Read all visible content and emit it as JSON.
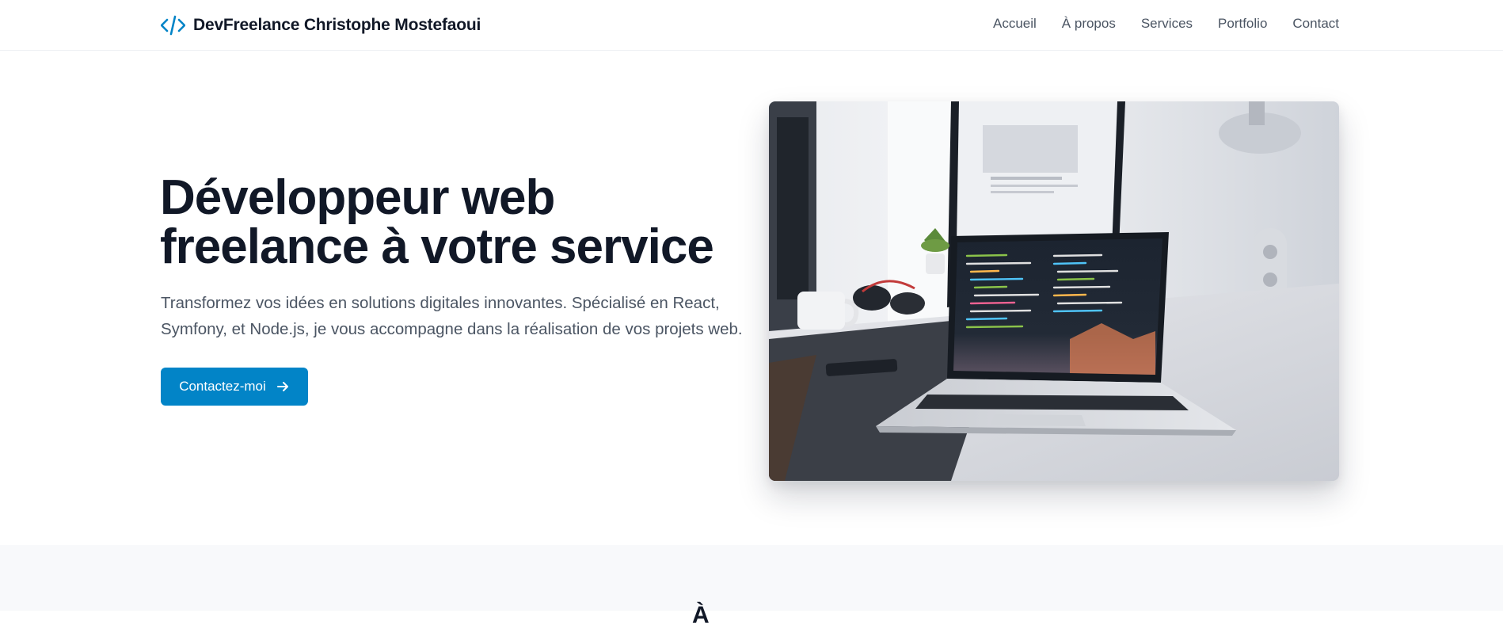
{
  "brand": {
    "icon": "code-icon",
    "name": "DevFreelance Christophe Mostefaoui",
    "accent_color": "#0284c7"
  },
  "nav": {
    "items": [
      {
        "label": "Accueil"
      },
      {
        "label": "À propos"
      },
      {
        "label": "Services"
      },
      {
        "label": "Portfolio"
      },
      {
        "label": "Contact"
      }
    ]
  },
  "hero": {
    "title_line1": "Développeur web",
    "title_line2": "freelance à votre service",
    "subtitle_line1": "Transformez vos idées en solutions digitales innovantes. Spécialisé en React,",
    "subtitle_line2": "Symfony, et Node.js, je vous accompagne dans la réalisation de vos projets web.",
    "cta_label": "Contactez-moi",
    "cta_icon": "arrow-right-icon",
    "cta_color": "#0284c7"
  },
  "next_section": {
    "peek_text": "À"
  }
}
